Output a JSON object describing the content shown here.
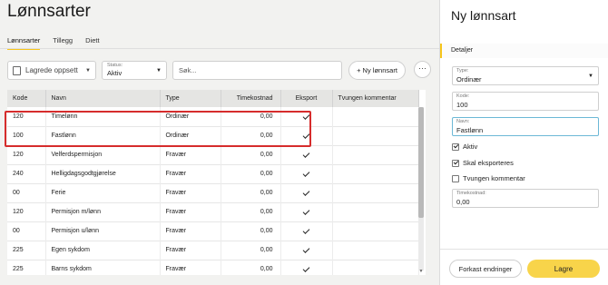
{
  "main": {
    "title": "Lønnsarter",
    "tabs": [
      {
        "label": "Lønnsarter",
        "active": true
      },
      {
        "label": "Tillegg",
        "active": false
      },
      {
        "label": "Diett",
        "active": false
      }
    ]
  },
  "toolbar": {
    "saved_views_label": "Lagrede oppsett",
    "status_label": "Status:",
    "status_value": "Aktiv",
    "search_placeholder": "Søk...",
    "new_button_label": "+ Ny lønnsart",
    "more_label": "···"
  },
  "table": {
    "columns": [
      "Kode",
      "Navn",
      "Type",
      "Timekostnad",
      "Eksport",
      "Tvungen kommentar"
    ],
    "rows": [
      {
        "kode": "120",
        "navn": "Timelønn",
        "type": "Ordinær",
        "timekostnad": "0,00",
        "eksport": true
      },
      {
        "kode": "100",
        "navn": "Fastlønn",
        "type": "Ordinær",
        "timekostnad": "0,00",
        "eksport": true
      },
      {
        "kode": "120",
        "navn": "Velferdspermisjon",
        "type": "Fravær",
        "timekostnad": "0,00",
        "eksport": true
      },
      {
        "kode": "240",
        "navn": "Helligdagsgodtgjørelse",
        "type": "Fravær",
        "timekostnad": "0,00",
        "eksport": true
      },
      {
        "kode": "00",
        "navn": "Ferie",
        "type": "Fravær",
        "timekostnad": "0,00",
        "eksport": true
      },
      {
        "kode": "120",
        "navn": "Permisjon m/lønn",
        "type": "Fravær",
        "timekostnad": "0,00",
        "eksport": true
      },
      {
        "kode": "00",
        "navn": "Permisjon u/lønn",
        "type": "Fravær",
        "timekostnad": "0,00",
        "eksport": true
      },
      {
        "kode": "225",
        "navn": "Egen sykdom",
        "type": "Fravær",
        "timekostnad": "0,00",
        "eksport": true
      },
      {
        "kode": "225",
        "navn": "Barns sykdom",
        "type": "Fravær",
        "timekostnad": "0,00",
        "eksport": true
      }
    ]
  },
  "panel": {
    "title": "Ny lønnsart",
    "section_tab": "Detaljer",
    "type_label": "Type:",
    "type_value": "Ordinær",
    "kode_label": "Kode:",
    "kode_value": "100",
    "navn_label": "Navn:",
    "navn_value": "Fastlønn",
    "cb_aktiv": "Aktiv",
    "cb_eksport": "Skal eksporteres",
    "cb_kommentar": "Tvungen kommentar",
    "timekostnad_label": "Timekostnad:",
    "timekostnad_value": "0,00",
    "cancel_label": "Forkast endringer",
    "save_label": "Lagre"
  },
  "colors": {
    "accent": "#f6c51b",
    "save_button": "#f8d44a",
    "highlight": "#d62c2c"
  }
}
